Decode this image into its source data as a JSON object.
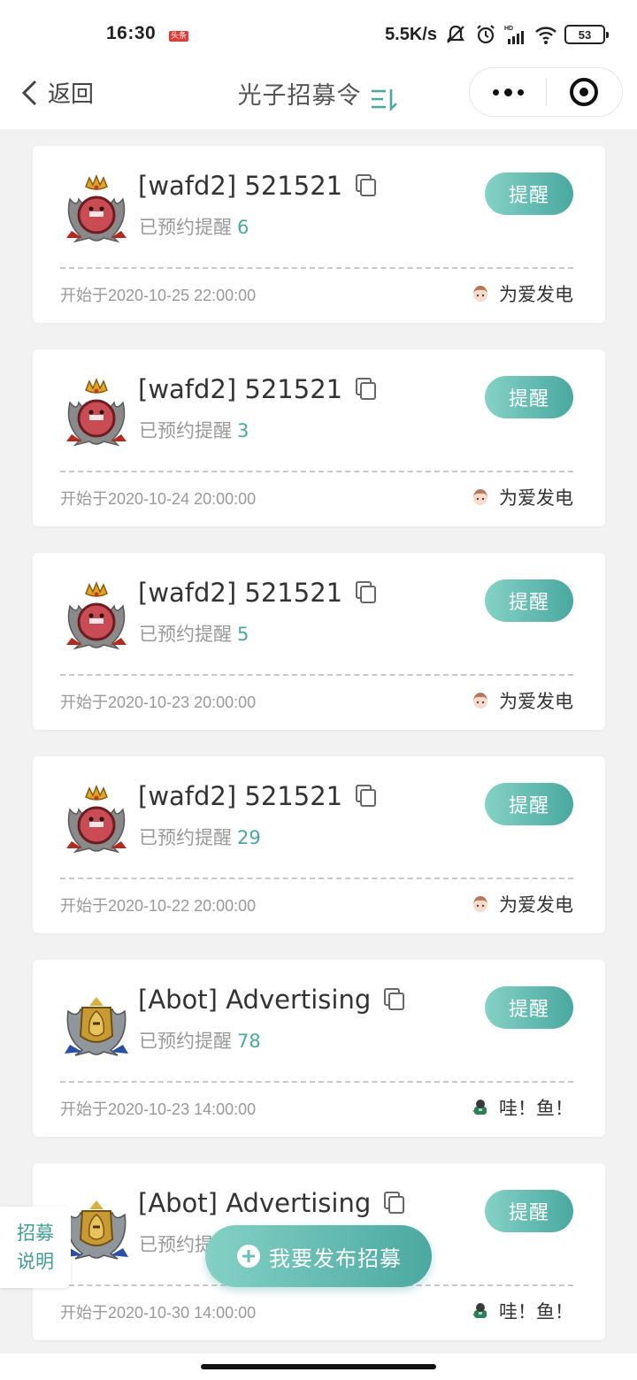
{
  "status_bar": {
    "time": "16:30",
    "badge": "头条",
    "net_speed": "5.5K/s",
    "battery": "53"
  },
  "nav": {
    "back_label": "返回",
    "title": "光子招募令"
  },
  "cards": [
    {
      "title": "[wafd2] 521521",
      "sub_label": "已预约提醒",
      "count": "6",
      "button": "提醒",
      "time": "开始于2020-10-25 22:00:00",
      "user": "为爱发电",
      "emblem": "red-lion-emblem-icon",
      "user_icon": "anime-girl-avatar-icon"
    },
    {
      "title": "[wafd2] 521521",
      "sub_label": "已预约提醒",
      "count": "3",
      "button": "提醒",
      "time": "开始于2020-10-24 20:00:00",
      "user": "为爱发电",
      "emblem": "red-lion-emblem-icon",
      "user_icon": "anime-girl-avatar-icon"
    },
    {
      "title": "[wafd2] 521521",
      "sub_label": "已预约提醒",
      "count": "5",
      "button": "提醒",
      "time": "开始于2020-10-23 20:00:00",
      "user": "为爱发电",
      "emblem": "red-lion-emblem-icon",
      "user_icon": "anime-girl-avatar-icon"
    },
    {
      "title": "[wafd2] 521521",
      "sub_label": "已预约提醒",
      "count": "29",
      "button": "提醒",
      "time": "开始于2020-10-22 20:00:00",
      "user": "为爱发电",
      "emblem": "red-lion-emblem-icon",
      "user_icon": "anime-girl-avatar-icon"
    },
    {
      "title": "[Abot] Advertising",
      "sub_label": "已预约提醒",
      "count": "78",
      "button": "提醒",
      "time": "开始于2020-10-23 14:00:00",
      "user": "哇！鱼！",
      "emblem": "gold-knight-emblem-icon",
      "user_icon": "fish-avatar-icon"
    },
    {
      "title": "[Abot] Advertising",
      "sub_label": "已预约提醒",
      "count": "",
      "button": "提醒",
      "time": "开始于2020-10-30 14:00:00",
      "user": "哇！鱼！",
      "emblem": "gold-knight-emblem-icon",
      "user_icon": "fish-avatar-icon"
    }
  ],
  "fab": {
    "label": "我要发布招募"
  },
  "side_tab": {
    "line1": "招募",
    "line2": "说明"
  },
  "colors": {
    "accent": "#4aa8a0",
    "accent_light": "#85d2c6"
  }
}
